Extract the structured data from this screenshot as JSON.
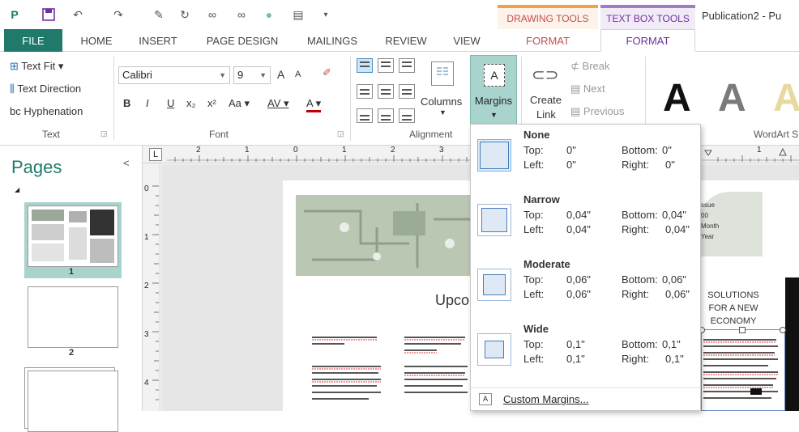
{
  "titlebar": {
    "context_drawing": "DRAWING TOOLS",
    "context_textbox": "TEXT BOX TOOLS",
    "window_title": "Publication2 - Pu"
  },
  "tabs": [
    "FILE",
    "HOME",
    "INSERT",
    "PAGE DESIGN",
    "MAILINGS",
    "REVIEW",
    "VIEW",
    "FORMAT",
    "FORMAT"
  ],
  "ribbon": {
    "text_group": {
      "text_fit": "Text Fit",
      "text_direction": "Text Direction",
      "hyphenation": "Hyphenation",
      "label": "Text"
    },
    "font_group": {
      "font_name": "Calibri",
      "font_size": "9",
      "bold": "B",
      "italic": "I",
      "underline": "U",
      "subscript": "x₂",
      "superscript": "x²",
      "change_case": "Aa",
      "char_spacing": "AV",
      "font_color": "A",
      "grow": "A",
      "shrink": "A",
      "label": "Font"
    },
    "alignment_group": {
      "columns": "Columns",
      "margins": "Margins",
      "margins_icon_letter": "A",
      "label": "Alignment"
    },
    "linking_group": {
      "create_link_1": "Create",
      "create_link_2": "Link",
      "break": "Break",
      "next": "Next",
      "previous": "Previous"
    },
    "wordart_group": {
      "label": "WordArt S",
      "sample_letter": "A"
    }
  },
  "pages_pane": {
    "title": "Pages",
    "collapse": "<",
    "page_numbers": [
      "1",
      "2"
    ]
  },
  "ruler": {
    "corner": "L",
    "h_ticks": [
      "2",
      "1",
      "0",
      "1",
      "2",
      "3",
      "1"
    ],
    "v_ticks": [
      "0",
      "1",
      "2",
      "3",
      "4"
    ]
  },
  "document": {
    "heading_partial": "Upco",
    "right_column_text": "SOLUTIONS FOR A NEW ECONOMY",
    "side_lines": [
      "ssue",
      "00",
      "Month",
      "Year"
    ]
  },
  "margins_menu": {
    "options": [
      {
        "name": "None",
        "top_label": "Top:",
        "top": "0\"",
        "left_label": "Left:",
        "left": "0\"",
        "bottom_label": "Bottom:",
        "bottom": "0\"",
        "right_label": "Right:",
        "right": "0\""
      },
      {
        "name": "Narrow",
        "top_label": "Top:",
        "top": "0,04\"",
        "left_label": "Left:",
        "left": "0,04\"",
        "bottom_label": "Bottom:",
        "bottom": "0,04\"",
        "right_label": "Right:",
        "right": "0,04\""
      },
      {
        "name": "Moderate",
        "top_label": "Top:",
        "top": "0,06\"",
        "left_label": "Left:",
        "left": "0,06\"",
        "bottom_label": "Bottom:",
        "bottom": "0,06\"",
        "right_label": "Right:",
        "right": "0,06\""
      },
      {
        "name": "Wide",
        "top_label": "Top:",
        "top": "0,1\"",
        "left_label": "Left:",
        "left": "0,1\"",
        "bottom_label": "Bottom:",
        "bottom": "0,1\"",
        "right_label": "Right:",
        "right": "0,1\""
      }
    ],
    "custom": "Custom Margins..."
  },
  "colors": {
    "accent": "#1f7a6b",
    "drawing_tools": "#f2a14a",
    "textbox_tools": "#a07fc1",
    "margins_highlight": "#a9d4ce"
  }
}
